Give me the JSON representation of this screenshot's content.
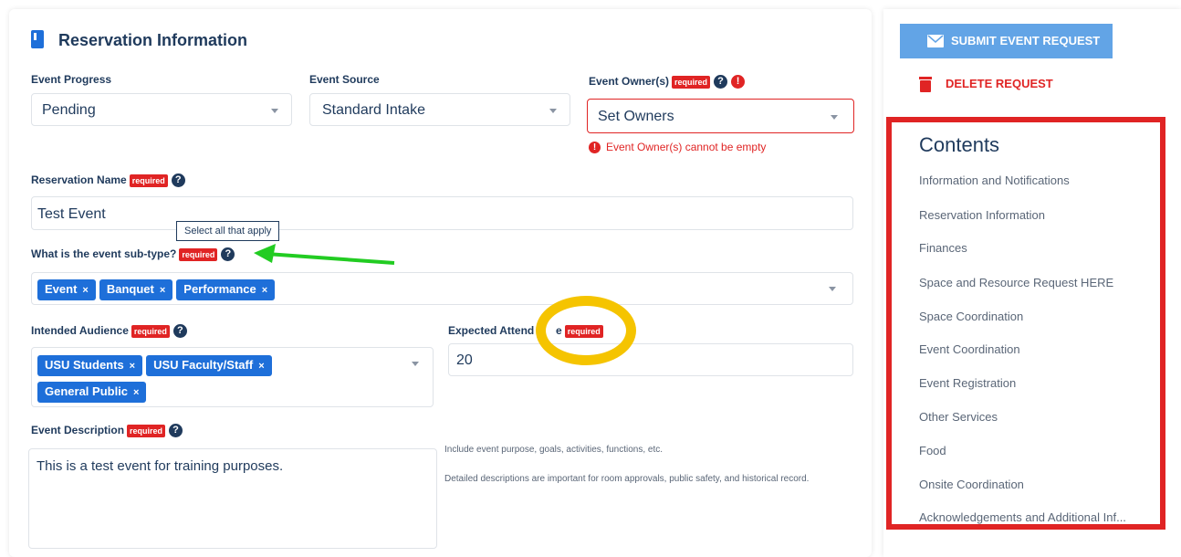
{
  "section": {
    "title": "Reservation Information"
  },
  "event_progress": {
    "label": "Event Progress",
    "value": "Pending"
  },
  "event_source": {
    "label": "Event Source",
    "value": "Standard Intake"
  },
  "event_owner": {
    "label": "Event Owner(s)",
    "required": "required",
    "placeholder": "Set Owners",
    "error": "Event Owner(s) cannot be empty"
  },
  "reservation_name": {
    "label": "Reservation Name",
    "required": "required",
    "value": "Test Event"
  },
  "sub_type": {
    "label": "What is the event sub-type?",
    "required": "required",
    "tooltip": "Select all that apply",
    "tags": [
      "Event",
      "Banquet",
      "Performance"
    ]
  },
  "audience": {
    "label": "Intended Audience",
    "required": "required",
    "tags": [
      "USU Students",
      "USU Faculty/Staff",
      "General Public"
    ]
  },
  "attendance": {
    "label_left": "Expected Attend",
    "label_right": "e",
    "required": "required",
    "value": "20"
  },
  "description": {
    "label": "Event Description",
    "required": "required",
    "value": "This is a test event for training purposes.",
    "hint1": "Include event purpose, goals, activities, functions, etc.",
    "hint2": "Detailed descriptions are important for room approvals, public safety, and historical record."
  },
  "actions": {
    "submit": "SUBMIT EVENT REQUEST",
    "delete": "DELETE REQUEST"
  },
  "contents": {
    "title": "Contents",
    "items": [
      "Information and Notifications",
      "Reservation Information",
      "Finances",
      "Space and Resource Request HERE",
      "Space Coordination",
      "Event Coordination",
      "Event Registration",
      "Other Services",
      "Food",
      "Onsite Coordination",
      "Acknowledgements and Additional Inf..."
    ]
  },
  "tag_remove": "×",
  "colors": {
    "accent": "#1e6fd9",
    "required": "#e02424",
    "annotation_arrow": "#22cc22",
    "annotation_circle": "#f5c400"
  },
  "icons": [
    "book-icon",
    "help-icon",
    "error-icon",
    "chevron-down-icon",
    "envelope-icon",
    "trash-icon",
    "remove-tag-icon"
  ]
}
